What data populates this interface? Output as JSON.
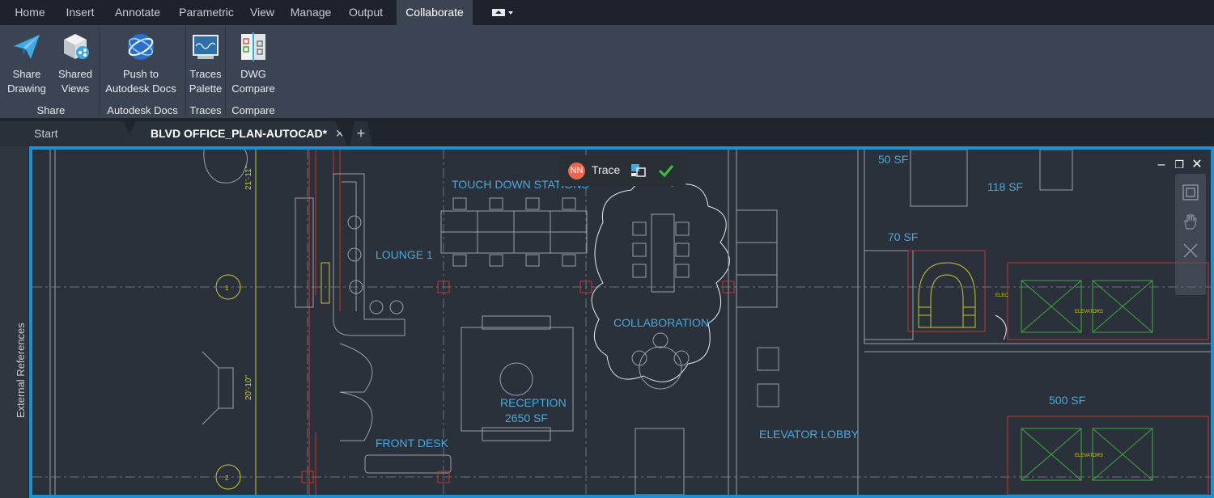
{
  "menu": {
    "tabs": [
      "Home",
      "Insert",
      "Annotate",
      "Parametric",
      "View",
      "Manage",
      "Output",
      "Collaborate"
    ],
    "active": "Collaborate"
  },
  "ribbon": {
    "buttons": [
      {
        "l1": "Share",
        "l2": "Drawing",
        "icon": "paper-plane-icon"
      },
      {
        "l1": "Shared",
        "l2": "Views",
        "icon": "shared-views-cube-icon"
      },
      {
        "l1": "Push to",
        "l2": "Autodesk Docs",
        "icon": "autodesk-docs-globe-icon"
      },
      {
        "l1": "Traces",
        "l2": "Palette",
        "icon": "traces-palette-icon"
      },
      {
        "l1": "DWG",
        "l2": "Compare",
        "icon": "dwg-compare-icon"
      }
    ],
    "panels": [
      "Share",
      "Autodesk Docs",
      "Traces",
      "Compare"
    ]
  },
  "doc_tabs": {
    "start": "Start",
    "active": "BLVD OFFICE_PLAN-AUTOCAD*",
    "close": "✕",
    "add": "+"
  },
  "side_palette": {
    "label": "External References"
  },
  "trace": {
    "initials": "NN",
    "label": "Trace"
  },
  "window_controls": {
    "minimize": "–",
    "restore": "❐",
    "close": "✕"
  },
  "drawing": {
    "labels": {
      "touch_down": "TOUCH DOWN STATIONS",
      "lounge": "LOUNGE 1",
      "collaboration": "COLLABORATION",
      "reception": "RECEPTION",
      "reception_area": "2650 SF",
      "front_desk": "FRONT DESK",
      "elevator_lobby": "ELEVATOR LOBBY",
      "sf50": "50 SF",
      "sf118": "118 SF",
      "sf70": "70 SF",
      "sf500": "500 SF",
      "elevators": "ELEVATORS",
      "elec": "ELEC"
    },
    "dims": {
      "d1": "21'-11\"",
      "d2": "20'-10\""
    },
    "grid_bubbles": [
      "1",
      "2"
    ]
  },
  "colors": {
    "accent": "#1e8fd0",
    "room_label": "#4aa8dc",
    "wall_red": "#c0392b",
    "line_gray": "#9aa0a8",
    "green": "#3ea83e",
    "yellow": "#c8c832"
  }
}
